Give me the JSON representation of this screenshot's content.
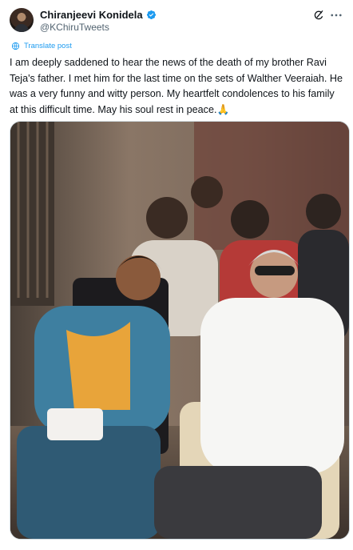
{
  "post": {
    "author_name": "Chiranjeevi Konidela",
    "handle": "@KChiruTweets",
    "translate_label": "Translate post",
    "text": "I am deeply saddened to hear the news of the death of my brother Ravi Teja's father. I met him for the last time on the sets of Walther Veeraiah. He was a very funny and witty person. My heartfelt condolences to his family at this difficult time. May his soul rest in peace.🙏"
  },
  "icons": {
    "verified": "verified-badge-icon",
    "grok": "grok-icon",
    "more": "more-options-icon",
    "translate": "translate-icon"
  },
  "colors": {
    "accent": "#1d9bf0",
    "text_primary": "#0f1419",
    "text_secondary": "#536471",
    "border": "#cfd9de"
  }
}
